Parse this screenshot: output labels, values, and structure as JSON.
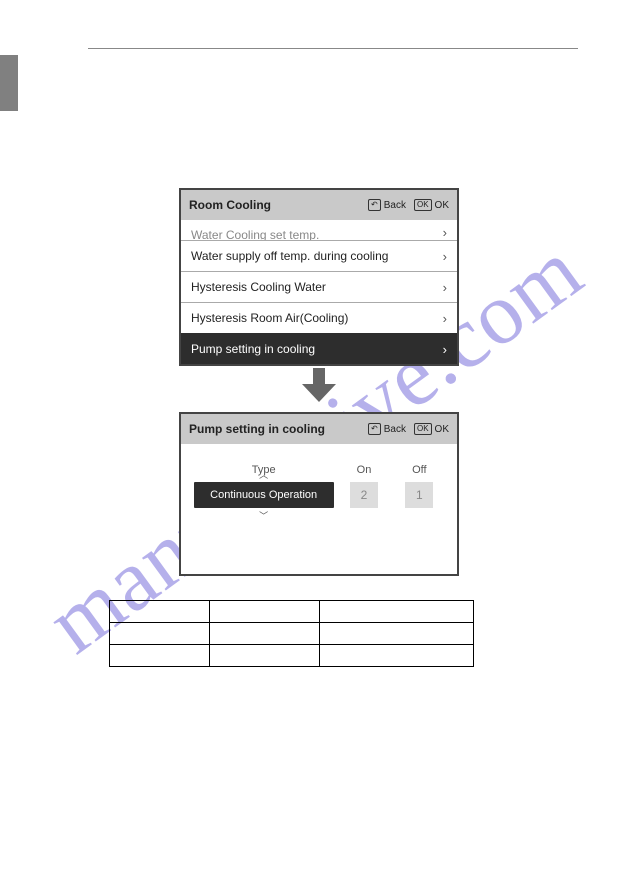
{
  "watermark": "manualshive.com",
  "screen1": {
    "title": "Room Cooling",
    "back": "Back",
    "ok": "OK",
    "rows": [
      {
        "label": "Water Cooling set temp."
      },
      {
        "label": "Water supply off temp. during cooling"
      },
      {
        "label": "Hysteresis Cooling Water"
      },
      {
        "label": "Hysteresis Room Air(Cooling)"
      },
      {
        "label": "Pump setting in cooling"
      }
    ]
  },
  "screen2": {
    "title": "Pump setting in cooling",
    "back": "Back",
    "ok": "OK",
    "headers": {
      "type": "Type",
      "on": "On",
      "off": "Off"
    },
    "values": {
      "type": "Continuous Operation",
      "on": "2",
      "off": "1"
    }
  }
}
